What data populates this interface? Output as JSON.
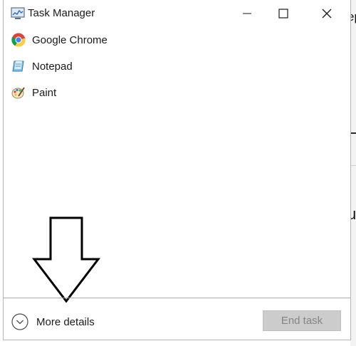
{
  "window": {
    "title": "Task Manager",
    "icon": "task-manager-icon",
    "controls": {
      "minimize": "minimize-icon",
      "maximize": "maximize-icon",
      "close": "close-icon"
    }
  },
  "apps": [
    {
      "label": "Google Chrome",
      "icon": "chrome-icon"
    },
    {
      "label": "Notepad",
      "icon": "notepad-icon"
    },
    {
      "label": "Paint",
      "icon": "paint-icon"
    }
  ],
  "footer": {
    "more_details_label": "More details",
    "more_details_icon": "chevron-down-circle-icon",
    "end_task_label": "End task",
    "end_task_enabled": false
  },
  "background_window": {
    "fragment_1": "ep",
    "fragment_2": "u"
  },
  "colors": {
    "button_disabled_bg": "#cccccc",
    "button_disabled_text": "#858585",
    "separator": "#a9a9a9"
  }
}
